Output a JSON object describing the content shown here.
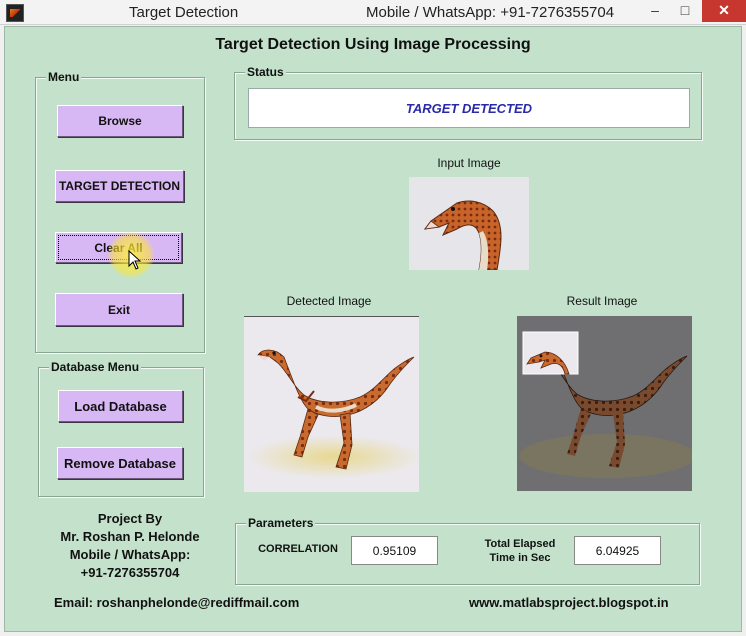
{
  "window": {
    "title": "Target Detection",
    "contact": "Mobile / WhatsApp: +91-7276355704",
    "minimize_glyph": "–",
    "maximize_glyph": "□",
    "close_glyph": "✕"
  },
  "heading": "Target Detection Using Image Processing",
  "menu": {
    "title": "Menu",
    "buttons": [
      "Browse",
      "TARGET DETECTION",
      "Clear All",
      "Exit"
    ]
  },
  "database_menu": {
    "title": "Database Menu",
    "buttons": [
      "Load Database",
      "Remove Database"
    ]
  },
  "status": {
    "title": "Status",
    "text": "TARGET DETECTED"
  },
  "images": {
    "input_label": "Input Image",
    "detected_label": "Detected Image",
    "result_label": "Result Image"
  },
  "credits": {
    "line1": "Project By",
    "line2": "Mr. Roshan P. Helonde",
    "line3": "Mobile / WhatsApp:",
    "line4": "+91-7276355704"
  },
  "parameters": {
    "title": "Parameters",
    "correlation_label": "CORRELATION",
    "correlation_value": "0.95109",
    "elapsed_label_1": "Total Elapsed",
    "elapsed_label_2": "Time in Sec",
    "elapsed_value": "6.04925"
  },
  "footer": {
    "email": "Email: roshanphelonde@rediffmail.com",
    "website": "www.matlabsproject.blogspot.in"
  },
  "colors": {
    "background": "#c4e2cb",
    "button": "#d8b8f4",
    "status_text": "#2a2aa8"
  }
}
